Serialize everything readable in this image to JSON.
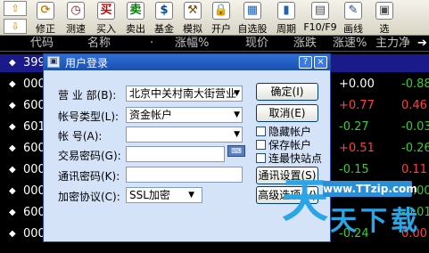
{
  "toolbar": {
    "items": [
      {
        "label": "修正",
        "icon": "⟳",
        "icon_name": "refresh-icon",
        "color": "#d08000"
      },
      {
        "label": "测速",
        "icon": "◷",
        "icon_name": "clock-icon",
        "color": "#c00000"
      },
      {
        "label": "买入",
        "icon": "买",
        "icon_name": "buy-icon",
        "color": "#d00000"
      },
      {
        "label": "卖出",
        "icon": "卖",
        "icon_name": "sell-icon",
        "color": "#008000"
      },
      {
        "label": "基金",
        "icon": "$",
        "icon_name": "fund-icon",
        "color": "#004a9a"
      },
      {
        "label": "模拟",
        "icon": "⚒",
        "icon_name": "hammer-icon",
        "color": "#7a4a10"
      },
      {
        "label": "开户",
        "icon": "🔒",
        "icon_name": "lock-icon",
        "color": "#a08000"
      },
      {
        "label": "自选股",
        "icon": "▦",
        "icon_name": "watchlist-icon",
        "color": "#2060b0"
      },
      {
        "label": "周期",
        "icon": "▮",
        "icon_name": "period-icon",
        "color": "#2060b0"
      },
      {
        "label": "F10/F9",
        "icon": "▤",
        "icon_name": "f10-icon",
        "color": "#505050"
      },
      {
        "label": "画线",
        "icon": "✎",
        "icon_name": "draw-line-icon",
        "color": "#2040a0"
      },
      {
        "label": "选",
        "icon": "▣",
        "icon_name": "select-icon",
        "color": "#505050"
      }
    ]
  },
  "quote_header": {
    "columns": [
      "代码",
      "名称",
      "·",
      "涨幅%",
      "现价",
      "涨跌",
      "涨速%",
      "主力净"
    ]
  },
  "quote_rows": [
    {
      "code": "399",
      "change": "",
      "speed": ""
    },
    {
      "code": "000",
      "change": "+0.00",
      "speed": "-0.88"
    },
    {
      "code": "600",
      "change": "+0.77",
      "speed": "0.46"
    },
    {
      "code": "601",
      "change": "-0.27",
      "speed": "-0.03"
    },
    {
      "code": "600",
      "change": "+0.51",
      "speed": "-0.26"
    },
    {
      "code": "000",
      "change": "-0.15",
      "speed": "0.11"
    },
    {
      "code": "000",
      "change": "",
      "speed": "-0.00"
    },
    {
      "code": "600",
      "change": "",
      "speed": "-0.01"
    },
    {
      "code": "000",
      "change": "-0.24",
      "speed": "0.00"
    }
  ],
  "dialog": {
    "title": "用户登录",
    "help": "?",
    "close": "×",
    "labels": {
      "branch": "营 业 部(B):",
      "account_type": "帐号类型(L):",
      "account": "帐    号(A):",
      "trade_password": "交易密码(G):",
      "comm_password": "通讯密码(K):",
      "protocol": "加密协议(C):"
    },
    "values": {
      "branch": "北京中关村南大街营业",
      "account_type": "资金帐户",
      "account": "",
      "trade_password": "",
      "comm_password": "",
      "protocol": "SSL加密"
    },
    "buttons": {
      "ok": "确定(I)",
      "cancel": "取消(E)",
      "comm_settings": "通讯设置(S)",
      "advanced": "高级选项(V)"
    },
    "checkboxes": {
      "hide_account": "隐藏帐户",
      "save_account": "保存帐户",
      "fastest_site": "连最快站点"
    }
  },
  "watermark": {
    "url": "www.TTzip.com",
    "big": "天",
    "small": "天下载"
  },
  "colors": {
    "up": "#ff4040",
    "down": "#30d030",
    "neutral": "#ffffff"
  }
}
